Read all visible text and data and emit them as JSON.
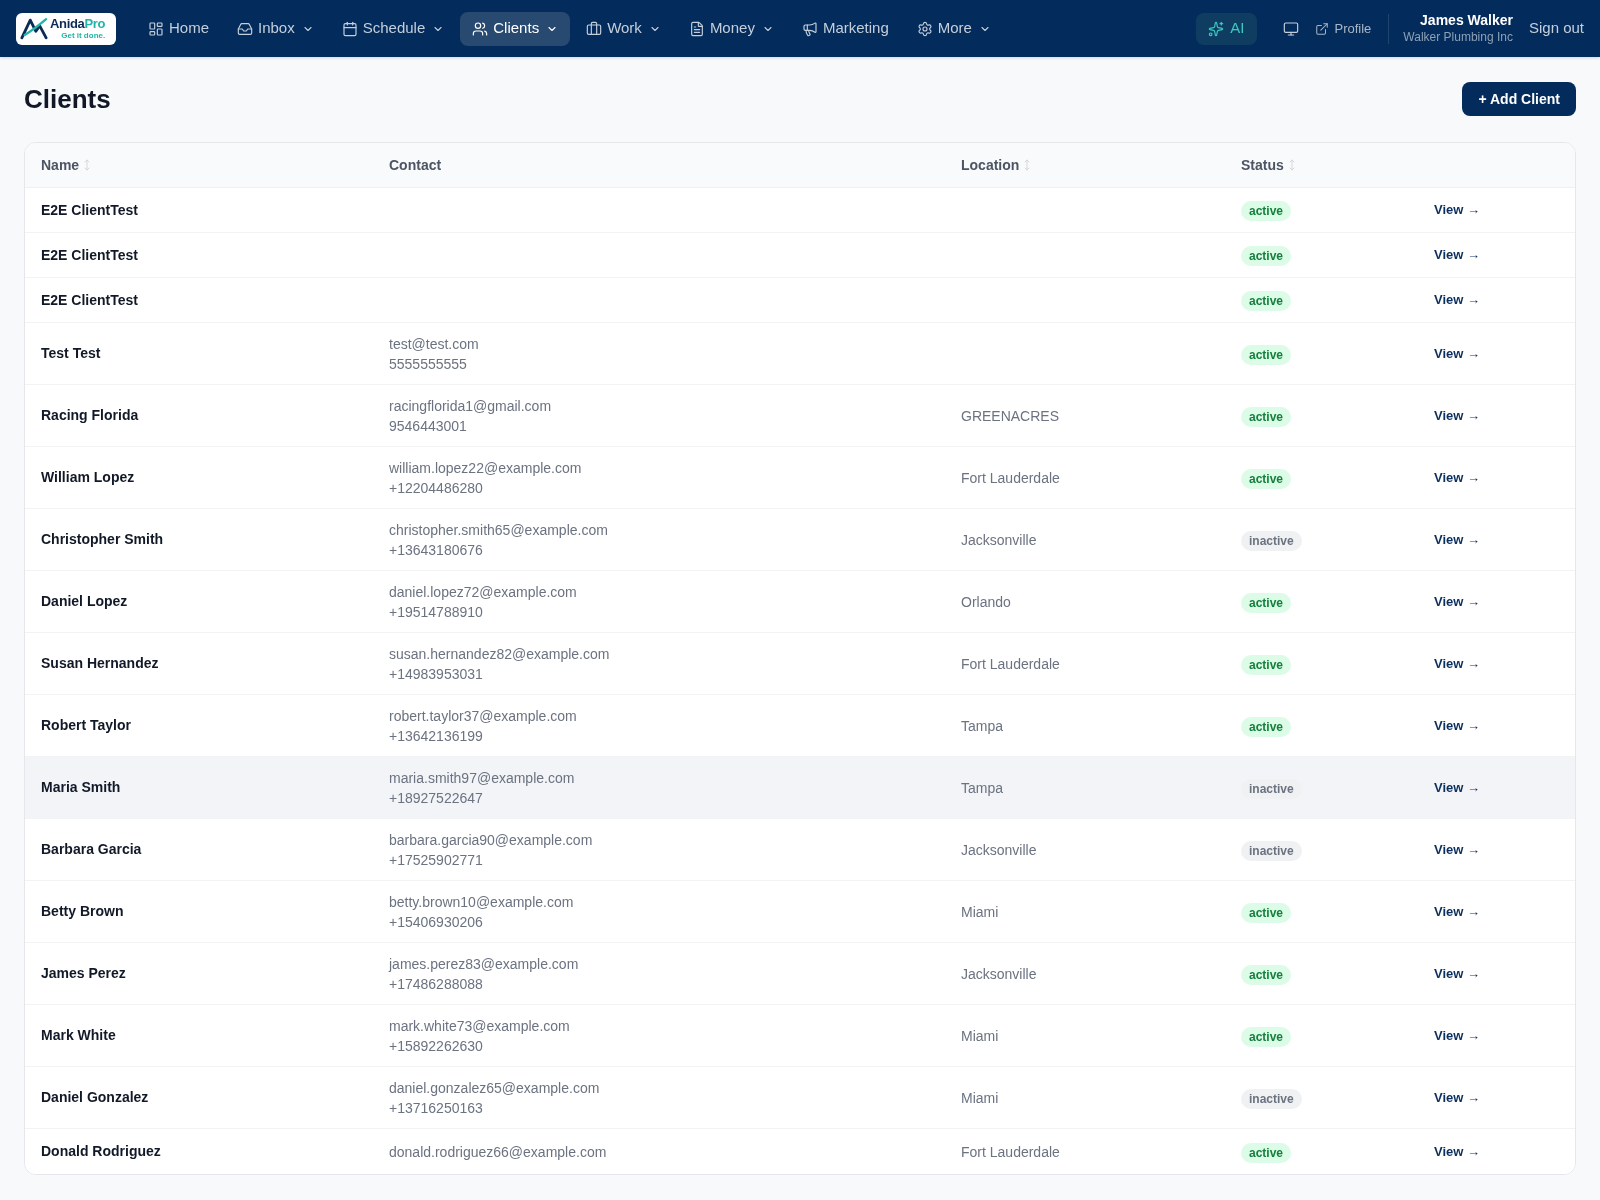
{
  "nav": {
    "logo": {
      "name": "Anida",
      "accent": "Pro",
      "tagline": "Get it done."
    },
    "items": [
      {
        "label": "Home",
        "dropdown": false,
        "selected": false
      },
      {
        "label": "Inbox",
        "dropdown": true,
        "selected": false
      },
      {
        "label": "Schedule",
        "dropdown": true,
        "selected": false
      },
      {
        "label": "Clients",
        "dropdown": true,
        "selected": true
      },
      {
        "label": "Work",
        "dropdown": true,
        "selected": false
      },
      {
        "label": "Money",
        "dropdown": true,
        "selected": false
      },
      {
        "label": "Marketing",
        "dropdown": false,
        "selected": false
      },
      {
        "label": "More",
        "dropdown": true,
        "selected": false
      }
    ],
    "ai": {
      "label": "AI"
    },
    "profile": {
      "label": "Profile"
    },
    "user": {
      "name": "James Walker",
      "company": "Walker Plumbing Inc"
    },
    "sign_out": "Sign out"
  },
  "page": {
    "title": "Clients",
    "add_button": "+ Add Client"
  },
  "table": {
    "columns": [
      {
        "label": "Name",
        "sortable": true
      },
      {
        "label": "Contact",
        "sortable": false
      },
      {
        "label": "Location",
        "sortable": true
      },
      {
        "label": "Status",
        "sortable": true
      }
    ],
    "rows": [
      {
        "name": "E2E ClientTest",
        "status": {
          "text": "active",
          "active": true
        },
        "action": "View →",
        "highlighted": false
      },
      {
        "name": "E2E ClientTest",
        "status": {
          "text": "active",
          "active": true
        },
        "action": "View →",
        "highlighted": false
      },
      {
        "name": "E2E ClientTest",
        "status": {
          "text": "active",
          "active": true
        },
        "action": "View →",
        "highlighted": false
      },
      {
        "name": "Test Test",
        "email": "test@test.com",
        "phone": "5555555555",
        "status": {
          "text": "active",
          "active": true
        },
        "action": "View →",
        "highlighted": false
      },
      {
        "name": "Racing Florida",
        "email": "racingflorida1@gmail.com",
        "phone": "9546443001",
        "location": "GREENACRES",
        "status": {
          "text": "active",
          "active": true
        },
        "action": "View →",
        "highlighted": false
      },
      {
        "name": "William Lopez",
        "email": "william.lopez22@example.com",
        "phone": "+12204486280",
        "location": "Fort Lauderdale",
        "status": {
          "text": "active",
          "active": true
        },
        "action": "View →",
        "highlighted": false
      },
      {
        "name": "Christopher Smith",
        "email": "christopher.smith65@example.com",
        "phone": "+13643180676",
        "location": "Jacksonville",
        "status": {
          "text": "inactive",
          "active": false
        },
        "action": "View →",
        "highlighted": false
      },
      {
        "name": "Daniel Lopez",
        "email": "daniel.lopez72@example.com",
        "phone": "+19514788910",
        "location": "Orlando",
        "status": {
          "text": "active",
          "active": true
        },
        "action": "View →",
        "highlighted": false
      },
      {
        "name": "Susan Hernandez",
        "email": "susan.hernandez82@example.com",
        "phone": "+14983953031",
        "location": "Fort Lauderdale",
        "status": {
          "text": "active",
          "active": true
        },
        "action": "View →",
        "highlighted": false
      },
      {
        "name": "Robert Taylor",
        "email": "robert.taylor37@example.com",
        "phone": "+13642136199",
        "location": "Tampa",
        "status": {
          "text": "active",
          "active": true
        },
        "action": "View →",
        "highlighted": false
      },
      {
        "name": "Maria Smith",
        "email": "maria.smith97@example.com",
        "phone": "+18927522647",
        "location": "Tampa",
        "status": {
          "text": "inactive",
          "active": false
        },
        "action": "View →",
        "highlighted": true
      },
      {
        "name": "Barbara Garcia",
        "email": "barbara.garcia90@example.com",
        "phone": "+17525902771",
        "location": "Jacksonville",
        "status": {
          "text": "inactive",
          "active": false
        },
        "action": "View →",
        "highlighted": false
      },
      {
        "name": "Betty Brown",
        "email": "betty.brown10@example.com",
        "phone": "+15406930206",
        "location": "Miami",
        "status": {
          "text": "active",
          "active": true
        },
        "action": "View →",
        "highlighted": false
      },
      {
        "name": "James Perez",
        "email": "james.perez83@example.com",
        "phone": "+17486288088",
        "location": "Jacksonville",
        "status": {
          "text": "active",
          "active": true
        },
        "action": "View →",
        "highlighted": false
      },
      {
        "name": "Mark White",
        "email": "mark.white73@example.com",
        "phone": "+15892262630",
        "location": "Miami",
        "status": {
          "text": "active",
          "active": true
        },
        "action": "View →",
        "highlighted": false
      },
      {
        "name": "Daniel Gonzalez",
        "email": "daniel.gonzalez65@example.com",
        "phone": "+13716250163",
        "location": "Miami",
        "status": {
          "text": "inactive",
          "active": false
        },
        "action": "View →",
        "highlighted": false
      },
      {
        "name": "Donald Rodriguez",
        "email": "donald.rodriguez66@example.com",
        "location": "Fort Lauderdale",
        "status": {
          "text": "active",
          "active": true
        },
        "action": "View →",
        "highlighted": false
      }
    ]
  }
}
